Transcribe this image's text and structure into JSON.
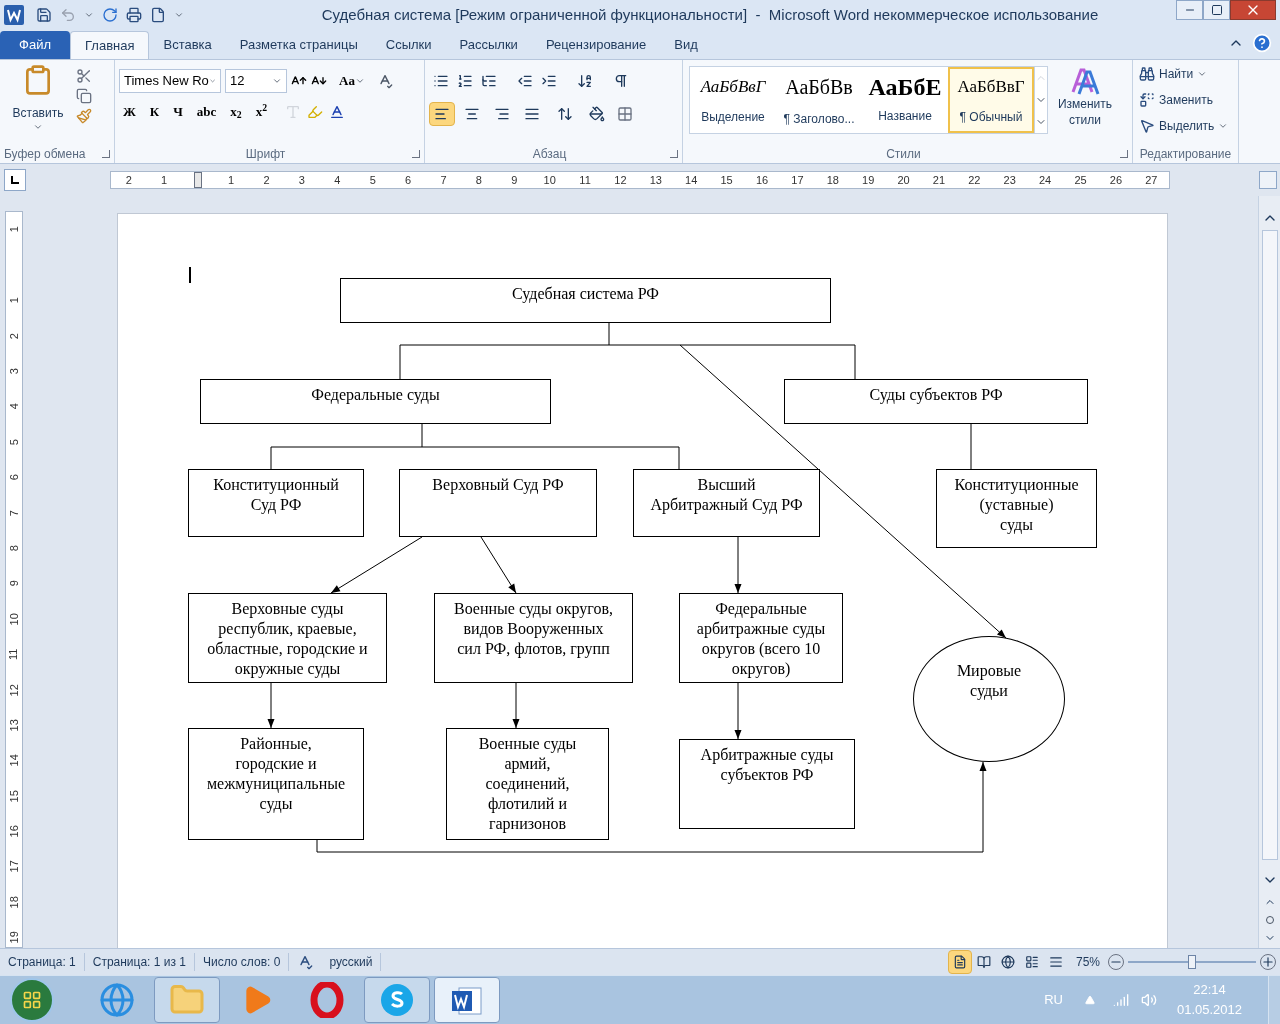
{
  "window": {
    "title": "Судебная система [Режим ограниченной функциональности]  -  Microsoft Word некоммерческое использование"
  },
  "file_tab": "Файл",
  "tabs": [
    {
      "label": "Главная",
      "selected": true
    },
    {
      "label": "Вставка",
      "selected": false
    },
    {
      "label": "Разметка страницы",
      "selected": false
    },
    {
      "label": "Ссылки",
      "selected": false
    },
    {
      "label": "Рассылки",
      "selected": false
    },
    {
      "label": "Рецензирование",
      "selected": false
    },
    {
      "label": "Вид",
      "selected": false
    }
  ],
  "ribbon": {
    "clipboard": {
      "paste": "Вставить",
      "label": "Буфер обмена"
    },
    "font": {
      "name": "Times New Ro",
      "size": "12",
      "case": "Aa",
      "buttons": [
        "Ж",
        "К",
        "Ч",
        "abc",
        "x$_{2}$",
        "x$^{2}$"
      ],
      "label": "Шрифт"
    },
    "paragraph": {
      "align": [
        {
          "selected": true
        },
        {
          "selected": false
        },
        {
          "selected": false
        },
        {
          "selected": false
        }
      ],
      "label": "Абзац"
    },
    "styles": {
      "items": [
        {
          "sample": "АаБбВвГ",
          "name": "Выделение",
          "kind": "italic",
          "selected": false
        },
        {
          "sample": "АаБбВв",
          "name": "¶ Заголово...",
          "kind": "heading",
          "selected": false
        },
        {
          "sample": "АаБбЕ",
          "name": "Название",
          "kind": "title",
          "selected": false
        },
        {
          "sample": "АаБбВвГ",
          "name": "¶ Обычный",
          "kind": "normal",
          "selected": true
        }
      ],
      "change": "Изменить стили",
      "label": "Стили"
    },
    "editing": {
      "items": [
        {
          "label": "Найти",
          "kind": "find"
        },
        {
          "label": "Заменить",
          "kind": "replace"
        },
        {
          "label": "Выделить",
          "kind": "select"
        }
      ],
      "label": "Редактирование"
    }
  },
  "ruler": {
    "horizontal": [
      "2",
      "1",
      "1",
      "2",
      "3",
      "4",
      "5",
      "6",
      "7",
      "8",
      "9",
      "10",
      "11",
      "12",
      "13",
      "14",
      "15",
      "16",
      "17",
      "18",
      "19",
      "20",
      "21",
      "22",
      "23",
      "24",
      "25",
      "26",
      "27"
    ],
    "vertical": [
      "1",
      "1",
      "2",
      "3",
      "4",
      "5",
      "6",
      "7",
      "8",
      "9",
      "10",
      "11",
      "12",
      "13",
      "14",
      "15",
      "16",
      "17",
      "18",
      "19"
    ]
  },
  "diagram": {
    "nodes": [
      {
        "text": "Судебная система РФ",
        "kind": "box"
      },
      {
        "text": "Федеральные суды",
        "kind": "box"
      },
      {
        "text": "Суды субъектов РФ",
        "kind": "box"
      },
      {
        "text": "Конституционный\nСуд РФ",
        "kind": "box"
      },
      {
        "text": "Верховный Суд РФ",
        "kind": "box"
      },
      {
        "text": "Высший\nАрбитражный Суд РФ",
        "kind": "box"
      },
      {
        "text": "Конституционные\n(уставные)\nсуды",
        "kind": "box"
      },
      {
        "text": "Верховные суды\nреспублик, краевые,\nобластные, городские и\nокружные суды",
        "kind": "box"
      },
      {
        "text": "Военные суды округов,\nвидов Вооруженных\nсил РФ, флотов, групп",
        "kind": "box"
      },
      {
        "text": "Федеральные\nарбитражные суды\nокругов (всего 10\nокругов)",
        "kind": "box"
      },
      {
        "text": "Мировые\nсудьи",
        "kind": "ellipse"
      },
      {
        "text": "Районные,\nгородские и\nмежмуниципальные\nсуды",
        "kind": "box"
      },
      {
        "text": "Военные суды\nармий,\nсоединений,\nфлотилий и\nгарнизонов",
        "kind": "box"
      },
      {
        "text": "Арбитражные суды\nсубъектов РФ",
        "kind": "box"
      }
    ]
  },
  "status_bar": {
    "items": [
      "Страница: 1",
      "Страница: 1 из 1",
      "Число слов: 0"
    ],
    "language": "русский",
    "views": [
      {
        "selected": true
      },
      {
        "selected": false
      },
      {
        "selected": false
      },
      {
        "selected": false
      },
      {
        "selected": false
      }
    ],
    "zoom": "75%",
    "level": 0.5
  },
  "taskbar": {
    "apps": [
      {
        "kind": "ie",
        "running": false,
        "selected": false
      },
      {
        "kind": "explorer",
        "running": true,
        "selected": false
      },
      {
        "kind": "media",
        "running": false,
        "selected": false
      },
      {
        "kind": "opera",
        "running": false,
        "selected": false
      },
      {
        "kind": "skype",
        "running": true,
        "selected": false
      },
      {
        "kind": "word",
        "running": true,
        "selected": true
      }
    ],
    "language": "RU",
    "time": "22:14",
    "date": "01.05.2012"
  }
}
